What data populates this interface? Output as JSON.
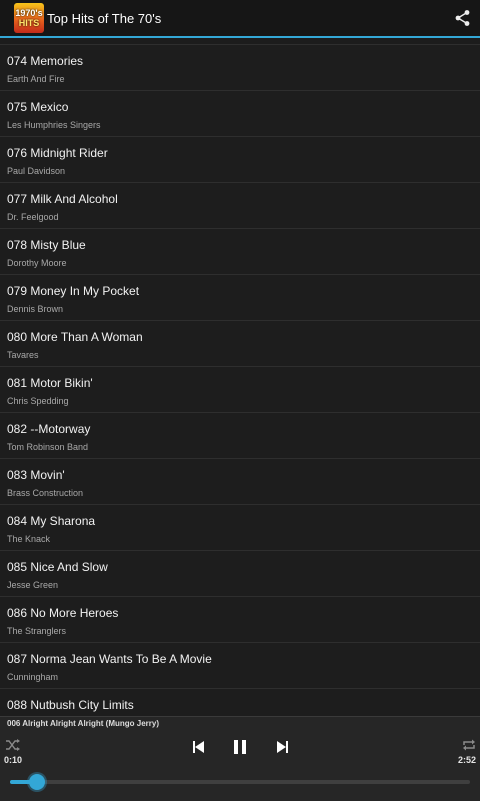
{
  "app": {
    "title": "Top Hits of The 70's",
    "icon_line1": "1970's",
    "icon_line2": "HITS",
    "accent_color": "#33a7d6"
  },
  "songs": [
    {
      "title": "074 Memories",
      "artist": "Earth And Fire"
    },
    {
      "title": "075 Mexico",
      "artist": "Les Humphries Singers"
    },
    {
      "title": "076 Midnight Rider",
      "artist": "Paul Davidson"
    },
    {
      "title": "077 Milk And Alcohol",
      "artist": "Dr. Feelgood"
    },
    {
      "title": "078 Misty Blue",
      "artist": "Dorothy Moore"
    },
    {
      "title": "079 Money In My Pocket",
      "artist": "Dennis Brown"
    },
    {
      "title": "080 More Than A Woman",
      "artist": "Tavares"
    },
    {
      "title": "081 Motor Bikin'",
      "artist": "Chris Spedding"
    },
    {
      "title": "082 --Motorway",
      "artist": "Tom Robinson Band"
    },
    {
      "title": "083 Movin'",
      "artist": "Brass Construction"
    },
    {
      "title": "084 My Sharona",
      "artist": "The Knack"
    },
    {
      "title": "085 Nice And Slow",
      "artist": "Jesse Green"
    },
    {
      "title": "086 No More Heroes",
      "artist": "The Stranglers"
    },
    {
      "title": "087 Norma Jean Wants To Be A Movie",
      "artist": "Cunningham"
    },
    {
      "title": "088 Nutbush City Limits",
      "artist": ""
    }
  ],
  "player": {
    "now_playing": "006 Alright Alright Alright (Mungo Jerry)",
    "elapsed": "0:10",
    "duration": "2:52",
    "progress_fraction": 0.058,
    "icons": [
      "shuffle-icon",
      "previous-icon",
      "pause-icon",
      "next-icon",
      "repeat-icon",
      "share-icon"
    ]
  }
}
